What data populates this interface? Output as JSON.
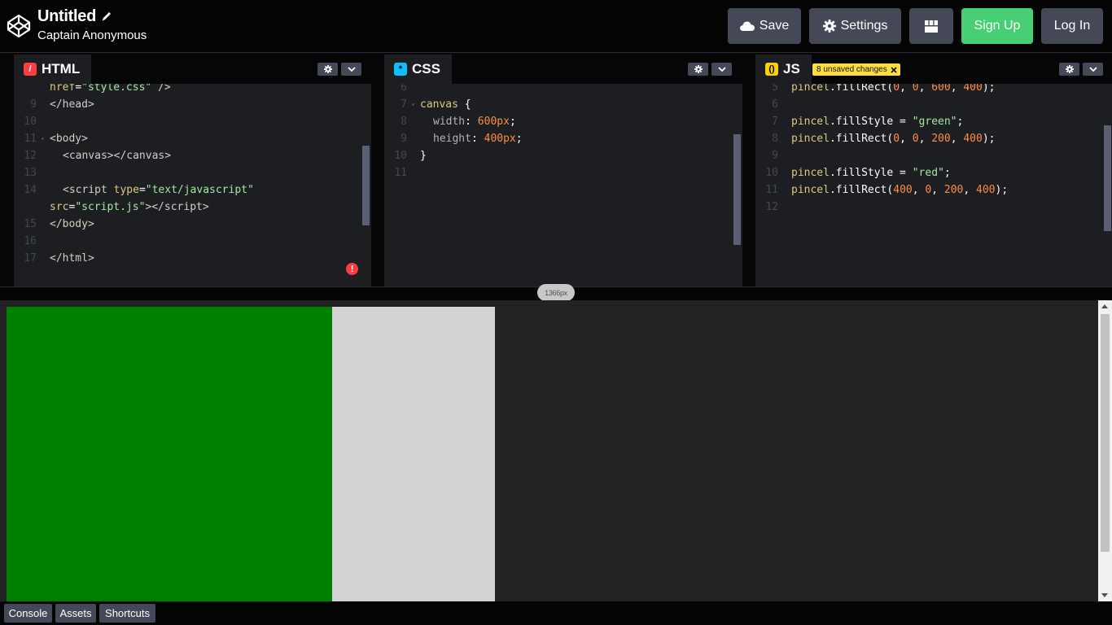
{
  "header": {
    "title": "Untitled",
    "subtitle": "Captain Anonymous",
    "save_label": "Save",
    "settings_label": "Settings",
    "signup_label": "Sign Up",
    "login_label": "Log In"
  },
  "editors": {
    "html": {
      "tab_label": "HTML",
      "badge": "/"
    },
    "css": {
      "tab_label": "CSS",
      "badge": "*"
    },
    "js": {
      "tab_label": "JS",
      "badge": "()",
      "unsaved_label": "8 unsaved changes"
    }
  },
  "preview": {
    "size_label": "1366px"
  },
  "footer": {
    "console_label": "Console",
    "assets_label": "Assets",
    "shortcuts_label": "Shortcuts"
  },
  "colors": {
    "brand_green": "#47cf73",
    "html_badge": "#ff3c41",
    "css_badge": "#0ebeff",
    "js_badge": "#fcd000",
    "canvas_green": "#008000",
    "canvas_gray": "#d3d3d3"
  }
}
